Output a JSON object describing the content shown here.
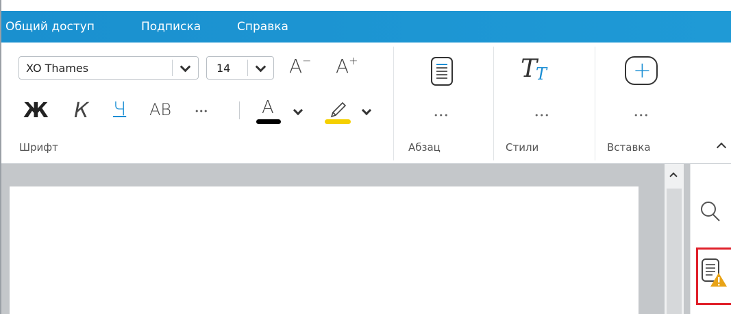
{
  "menu": {
    "items": [
      "Общий доступ",
      "Подписка",
      "Справка"
    ]
  },
  "font_group": {
    "font_name": "XO Thames",
    "font_size": "14",
    "decrease_label": "A",
    "increase_label": "A",
    "decrease_sup": "−",
    "increase_sup": "+",
    "bold_label": "Ж",
    "italic_label": "К",
    "underline_label": "Ч",
    "caps_label": "АВ",
    "more_label": "•••",
    "font_color_label": "A",
    "font_color": "#000000",
    "highlight_color": "#f5d000",
    "label": "Шрифт"
  },
  "paragraph_group": {
    "more_label": "•••",
    "label": "Абзац"
  },
  "styles_group": {
    "icon_letter": "T",
    "sub_letter": "T",
    "more_label": "•••",
    "label": "Стили"
  },
  "insert_group": {
    "icon_symbol": "+",
    "more_label": "•••",
    "label": "Вставка"
  },
  "colors": {
    "menubar": "#1f9ad6",
    "highlight_box": "#e0202a",
    "warning": "#e8a317",
    "accent_blue": "#1a8ed4"
  }
}
